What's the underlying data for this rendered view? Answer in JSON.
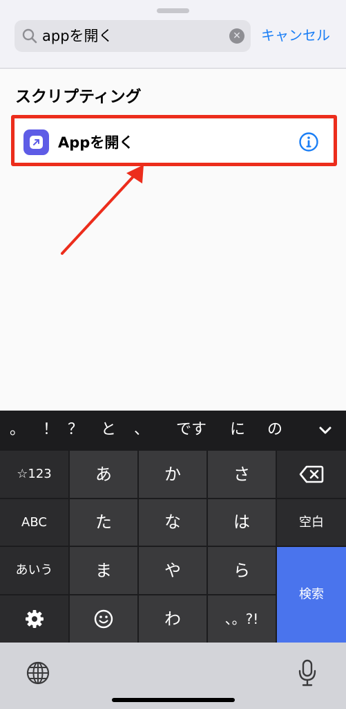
{
  "search": {
    "query": "appを開く",
    "cancel_label": "キャンセル"
  },
  "section": {
    "title": "スクリプティング"
  },
  "result": {
    "label": "Appを開く",
    "icon": "open-app-icon",
    "accent": "#5e5ce6"
  },
  "annotation": {
    "highlight_color": "#ec2d1c"
  },
  "keyboard": {
    "suggestions": [
      "。",
      "！",
      "？",
      "と",
      "、",
      "です",
      "に",
      "の"
    ],
    "row1": [
      "☆123",
      "あ",
      "か",
      "さ"
    ],
    "row2": [
      "ABC",
      "た",
      "な",
      "は",
      "空白"
    ],
    "row3": [
      "あいう",
      "ま",
      "や",
      "ら"
    ],
    "row4": [
      "わ",
      "、。?!"
    ],
    "search_label": "検索",
    "search_color": "#4a74ed"
  }
}
